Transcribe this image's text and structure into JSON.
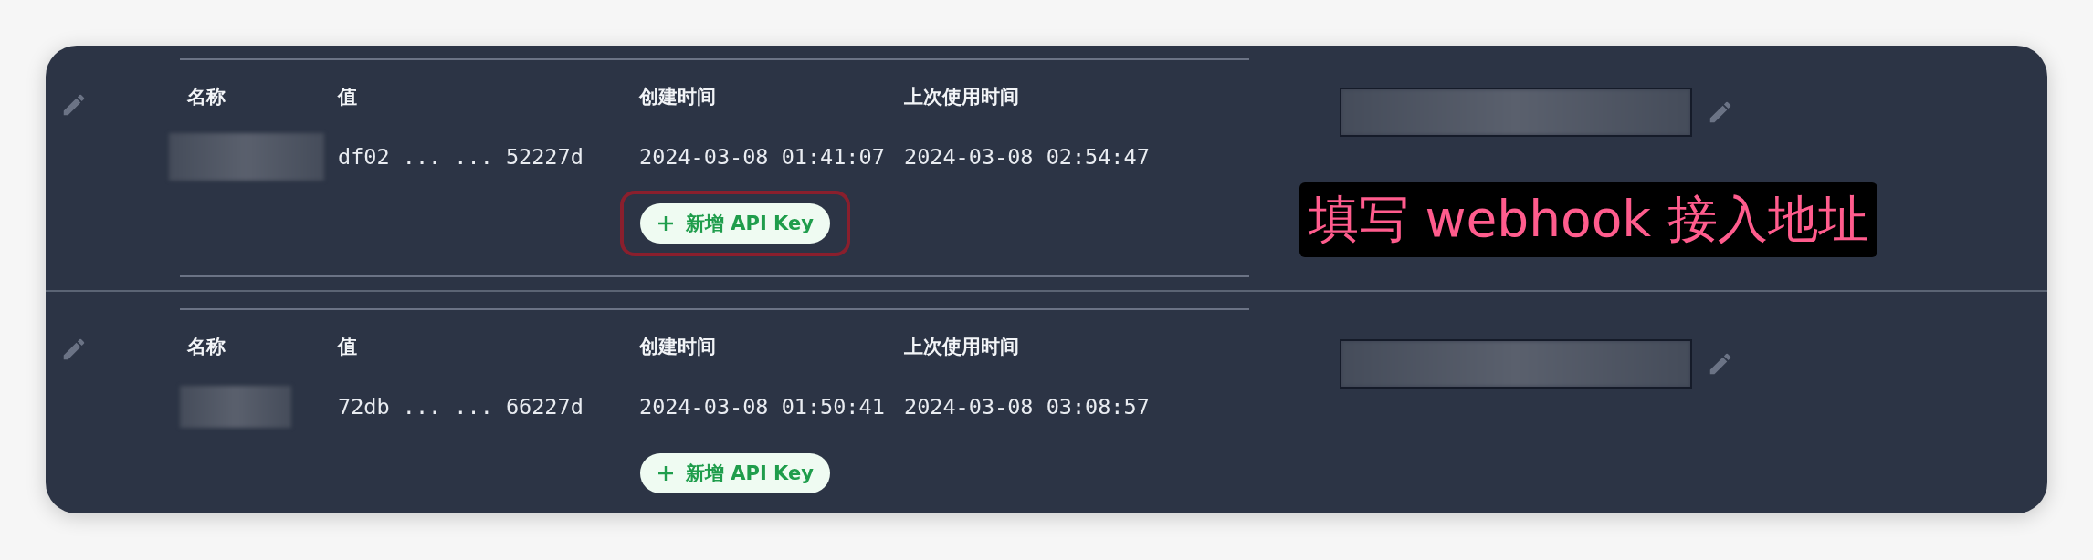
{
  "groups": [
    {
      "columns": [
        "名称",
        "值",
        "创建时间",
        "上次使用时间"
      ],
      "keys": [
        {
          "name_hidden": true,
          "value": "df02 ... ... 52227d",
          "created": "2024-03-08 01:41:07",
          "last_used": "2024-03-08 02:54:47"
        }
      ],
      "add_button": {
        "label": "新增 API Key",
        "highlighted": true
      },
      "webhook_hidden": true,
      "annotation": "填写 webhook 接入地址"
    },
    {
      "columns": [
        "名称",
        "值",
        "创建时间",
        "上次使用时间"
      ],
      "keys": [
        {
          "name_hidden": true,
          "value": "72db ... ... 66227d",
          "created": "2024-03-08 01:50:41",
          "last_used": "2024-03-08 03:08:57"
        }
      ],
      "add_button": {
        "label": "新增 API Key",
        "highlighted": false
      },
      "webhook_hidden": true
    }
  ]
}
